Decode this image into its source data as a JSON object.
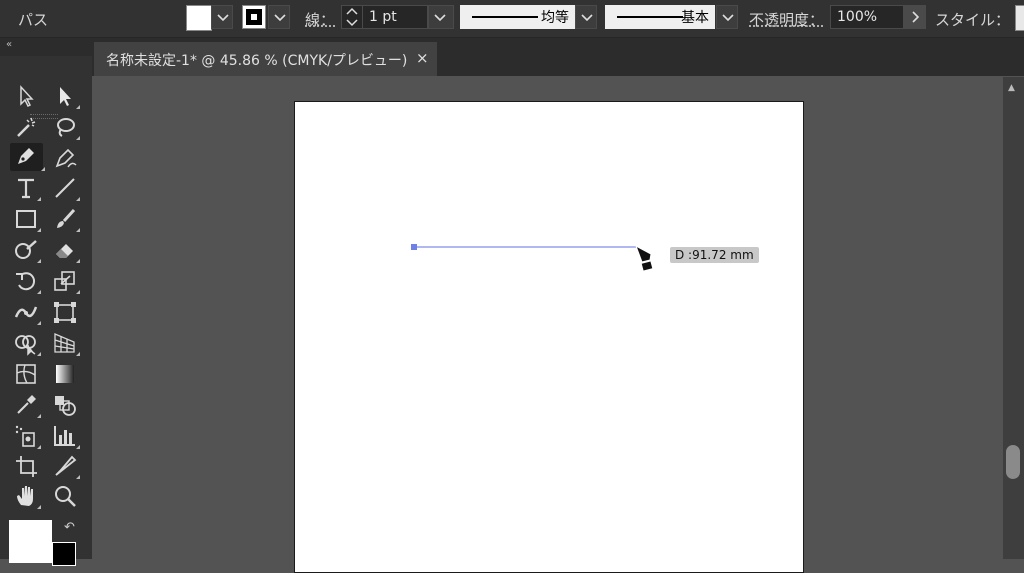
{
  "control_bar": {
    "mode_label": "パス",
    "stroke_label": "線：",
    "stroke_weight": "1 pt",
    "profile_label": "均等",
    "brush_label": "基本",
    "opacity_label": "不透明度：",
    "opacity_value": "100%",
    "style_label": "スタイル："
  },
  "document_tab": {
    "title": "名称未設定-1* @ 45.86 % (CMYK/プレビュー)",
    "close_glyph": "×"
  },
  "panel_collapse_glyph": "«",
  "tool_icons": [
    "selection-tool-icon",
    "direct-selection-tool-icon",
    "magic-wand-tool-icon",
    "lasso-tool-icon",
    "pen-tool-icon",
    "curvature-tool-icon",
    "type-tool-icon",
    "line-segment-tool-icon",
    "rectangle-tool-icon",
    "paintbrush-tool-icon",
    "shaper-tool-icon",
    "eraser-tool-icon",
    "rotate-tool-icon",
    "scale-tool-icon",
    "width-tool-icon",
    "free-transform-tool-icon",
    "shape-builder-tool-icon",
    "perspective-grid-tool-icon",
    "mesh-tool-icon",
    "gradient-tool-icon",
    "eyedropper-tool-icon",
    "blend-tool-icon",
    "symbol-sprayer-tool-icon",
    "column-graph-tool-icon",
    "artboard-tool-icon",
    "slice-tool-icon",
    "hand-tool-icon",
    "zoom-tool-icon"
  ],
  "canvas": {
    "distance_readout": "D :91.72 mm",
    "path_color": "#7f8ee8"
  }
}
